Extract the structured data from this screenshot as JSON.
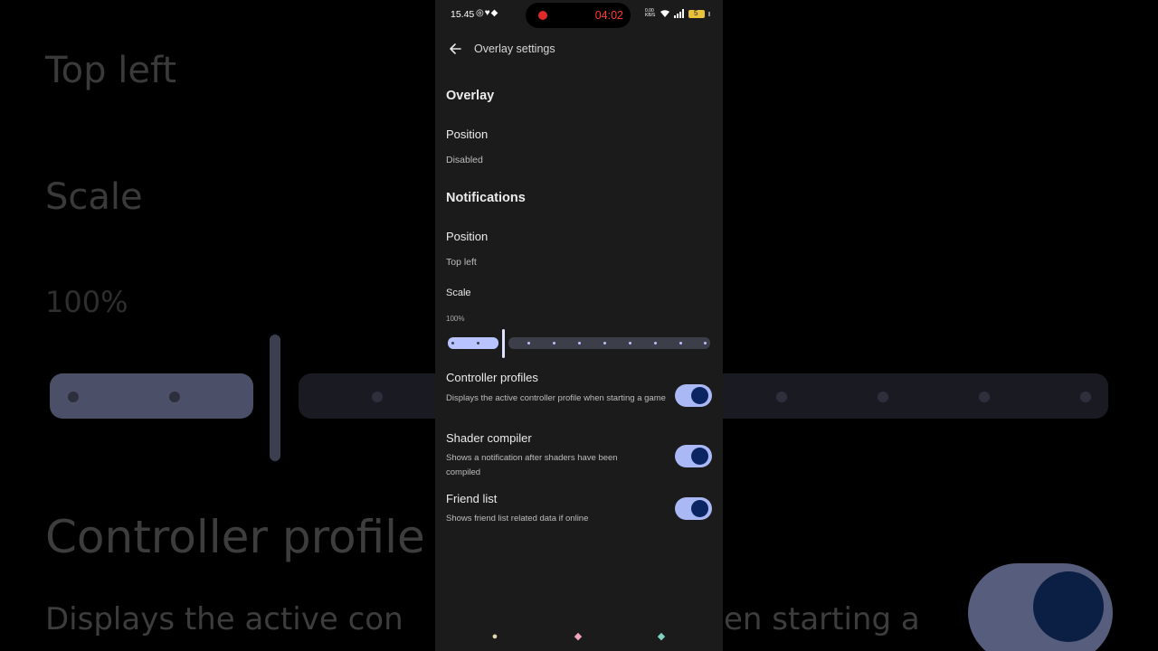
{
  "status_bar": {
    "time": "15.45",
    "notif_icons": [
      "whatsapp-icon",
      "heart-icon",
      "game-controller-icon"
    ],
    "recording_time": "04:02",
    "right_icons": [
      "network-speed-icon",
      "wifi-icon",
      "4g-signal-icon",
      "battery-icon"
    ],
    "network_speed": "0.00 KB/S",
    "battery_level": "5"
  },
  "appbar": {
    "title": "Overlay settings"
  },
  "overlay": {
    "section_title": "Overlay",
    "position_label": "Position",
    "position_value": "Disabled"
  },
  "notifications": {
    "section_title": "Notifications",
    "position_label": "Position",
    "position_value": "Top left",
    "scale_label": "Scale",
    "scale_value": "100%",
    "scale_fraction": 0.2,
    "items": [
      {
        "title": "Controller profiles",
        "description": "Displays the active controller profile when starting a game",
        "enabled": true
      },
      {
        "title": "Shader compiler",
        "description": "Shows a notification after shaders have been compiled",
        "enabled": true
      },
      {
        "title": "Friend list",
        "description": "Shows friend list related data if online",
        "enabled": true
      }
    ]
  },
  "nav_bar": {
    "icons": [
      "shell-icon",
      "candy-icon",
      "leaf-icon"
    ]
  },
  "background_echo": {
    "top_left": "Top left",
    "scale": "Scale",
    "percent": "100%",
    "controller": "Controller profile",
    "desc_left": "Displays the active con",
    "desc_right": "en starting a"
  },
  "colors": {
    "accent": "#b9c3ff",
    "toggle_track": "#aab8f5",
    "toggle_knob": "#0b2563",
    "recording": "#ff3b30",
    "background": "#1b1b1b"
  }
}
